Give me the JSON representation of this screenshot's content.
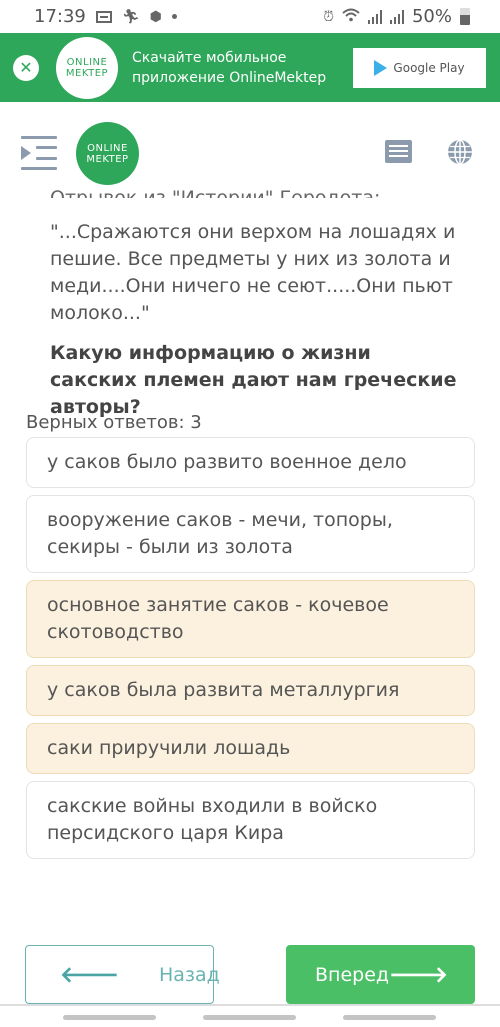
{
  "status_bar": {
    "time": "17:39",
    "battery": "50%",
    "left_icons": [
      "calendar-icon",
      "runner-icon",
      "shield-icon",
      "dot-icon"
    ],
    "right_icons": [
      "alarm-icon",
      "wifi-icon",
      "signal-icon",
      "signal-icon",
      "battery-icon"
    ]
  },
  "banner": {
    "logo_line1": "ONLINE",
    "logo_line2": "MEKTEP",
    "text": "Скачайте мобильное приложение OnlineMektep",
    "store_label": "Google Play",
    "close_icon": "close-icon"
  },
  "header": {
    "logo_line1": "ONLINE",
    "logo_line2": "MEKTEP",
    "icons": [
      "menu-toggle-icon",
      "list-icon",
      "globe-icon"
    ]
  },
  "question": {
    "source_line": "Отрывок из \"Истории\" Геродота:",
    "quote": "\"...Сражаются они верхом на лошадях и пешие. Все предметы у них из золота и меди....Они ничего не сеют.....Они пьют молоко...\"",
    "prompt": "Какую информацию о жизни сакских племен дают нам греческие авторы?",
    "correct_count_label": "Верных ответов: 3"
  },
  "answers": [
    {
      "text": "у саков было развито военное дело",
      "selected": false
    },
    {
      "text": "вооружение саков - мечи, топоры, секиры - были из золота",
      "selected": false
    },
    {
      "text": "основное занятие саков - кочевое скотоводство",
      "selected": true
    },
    {
      "text": "у саков была развита металлургия",
      "selected": true
    },
    {
      "text": "саки приручили лошадь",
      "selected": true
    },
    {
      "text": "сакские войны входили в войско персидского царя Кира",
      "selected": false
    }
  ],
  "nav": {
    "back_label": "Назад",
    "next_label": "Вперед",
    "back_arrow": "🡐",
    "next_arrow": "🡒"
  },
  "colors": {
    "brand_green": "#2ea75a",
    "next_button": "#4bbf66",
    "back_button_border": "#6bb3b2",
    "selected_answer_bg": "#fbf1de",
    "icon_gray": "#8b9aac"
  }
}
